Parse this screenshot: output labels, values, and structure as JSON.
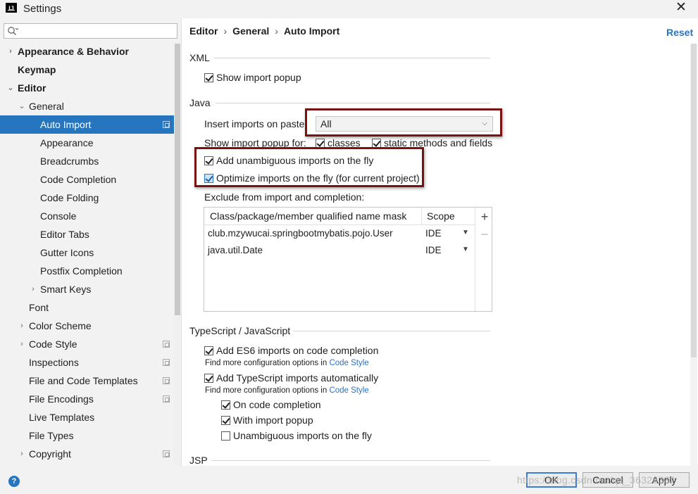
{
  "window": {
    "app_icon_text": "IJ",
    "title": "Settings",
    "close_glyph": "✕"
  },
  "search": {
    "placeholder": "",
    "value": ""
  },
  "sidebar": {
    "items": [
      {
        "label": "Appearance & Behavior",
        "arrow": "›",
        "bold": true
      },
      {
        "label": "Keymap",
        "bold": true
      },
      {
        "label": "Editor",
        "arrow": "⌄",
        "bold": true
      },
      {
        "label": "General",
        "arrow": "⌄"
      },
      {
        "label": "Auto Import",
        "selected": true,
        "copy_icon": true
      },
      {
        "label": "Appearance"
      },
      {
        "label": "Breadcrumbs"
      },
      {
        "label": "Code Completion"
      },
      {
        "label": "Code Folding"
      },
      {
        "label": "Console"
      },
      {
        "label": "Editor Tabs"
      },
      {
        "label": "Gutter Icons"
      },
      {
        "label": "Postfix Completion"
      },
      {
        "label": "Smart Keys",
        "arrow": "›"
      },
      {
        "label": "Font"
      },
      {
        "label": "Color Scheme",
        "arrow": "›"
      },
      {
        "label": "Code Style",
        "arrow": "›",
        "copy_icon": true
      },
      {
        "label": "Inspections",
        "copy_icon": true
      },
      {
        "label": "File and Code Templates",
        "copy_icon": true
      },
      {
        "label": "File Encodings",
        "copy_icon": true
      },
      {
        "label": "Live Templates"
      },
      {
        "label": "File Types"
      },
      {
        "label": "Copyright",
        "arrow": "›",
        "copy_icon": true
      }
    ]
  },
  "breadcrumb": {
    "part1": "Editor",
    "sep": "›",
    "part2": "General",
    "part3": "Auto Import"
  },
  "reset_label": "Reset",
  "xml": {
    "section": "XML",
    "show_import_popup": {
      "label": "Show import popup",
      "checked": true
    }
  },
  "java": {
    "section": "Java",
    "insert_imports_label": "Insert imports on paste:",
    "insert_imports_value": "All",
    "show_popup_for_label": "Show import popup for:",
    "classes": {
      "label": "classes",
      "checked": true
    },
    "static_methods": {
      "label": "static methods and fields",
      "checked": true
    },
    "add_unambiguous": {
      "label": "Add unambiguous imports on the fly",
      "checked": true
    },
    "optimize_imports": {
      "label": "Optimize imports on the fly (for current project)",
      "checked": true
    },
    "exclude_label": "Exclude from import and completion:",
    "exclude_table": {
      "columns": [
        "Class/package/member qualified name mask",
        "Scope"
      ],
      "rows": [
        {
          "mask": "club.mzywucai.springbootmybatis.pojo.User",
          "scope": "IDE"
        },
        {
          "mask": "java.util.Date",
          "scope": "IDE"
        }
      ],
      "add_glyph": "+",
      "remove_glyph": "−"
    }
  },
  "typescript": {
    "section": "TypeScript / JavaScript",
    "es6_imports": {
      "label": "Add ES6 imports on code completion",
      "checked": true
    },
    "hint1_text": "Find more configuration options in ",
    "hint1_link": "Code Style",
    "ts_imports": {
      "label": "Add TypeScript imports automatically",
      "checked": true
    },
    "hint2_text": "Find more configuration options in ",
    "hint2_link": "Code Style",
    "on_code_completion": {
      "label": "On code completion",
      "checked": true
    },
    "with_import_popup": {
      "label": "With import popup",
      "checked": true
    },
    "unambiguous_on_fly": {
      "label": "Unambiguous imports on the fly",
      "checked": false
    }
  },
  "jsp": {
    "section": "JSP"
  },
  "footer": {
    "help_glyph": "?",
    "ok": "OK",
    "cancel": "Cancel",
    "apply": "Apply",
    "watermark": "https://blog.csdn.net/qq_36326332"
  },
  "colors": {
    "selection": "#2675bf",
    "link": "#2a73c2",
    "highlight_box": "#7a1212"
  }
}
